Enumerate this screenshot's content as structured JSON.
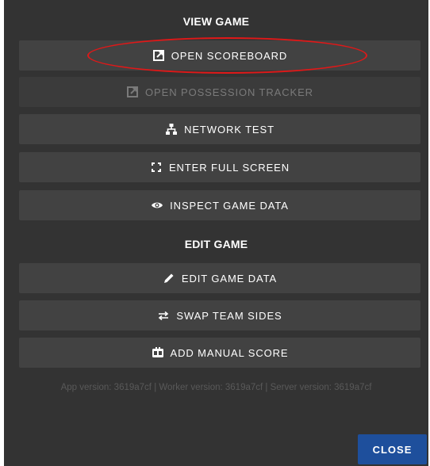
{
  "dialog": {
    "view_section_title": "VIEW GAME",
    "edit_section_title": "EDIT GAME",
    "view_buttons": [
      {
        "label": "OPEN SCOREBOARD",
        "icon": "open-external-icon",
        "enabled": true
      },
      {
        "label": "OPEN POSSESSION TRACKER",
        "icon": "open-external-icon",
        "enabled": false
      },
      {
        "label": "NETWORK TEST",
        "icon": "network-icon",
        "enabled": true
      },
      {
        "label": "ENTER FULL SCREEN",
        "icon": "fullscreen-icon",
        "enabled": true
      },
      {
        "label": "INSPECT GAME DATA",
        "icon": "eye-icon",
        "enabled": true
      }
    ],
    "edit_buttons": [
      {
        "label": "EDIT GAME DATA",
        "icon": "pencil-icon",
        "enabled": true
      },
      {
        "label": "SWAP TEAM SIDES",
        "icon": "swap-arrows-icon",
        "enabled": true
      },
      {
        "label": "ADD MANUAL SCORE",
        "icon": "scoreboard-icon",
        "enabled": true
      }
    ],
    "version_text": "App version: 3619a7cf | Worker version: 3619a7cf | Server version: 3619a7cf",
    "close_label": "CLOSE"
  },
  "colors": {
    "modal_background": "#333333",
    "button_background": "#424242",
    "close_button": "#1e4f9c",
    "annotation": "#e01818",
    "disabled_text": "#7a7a7a"
  }
}
